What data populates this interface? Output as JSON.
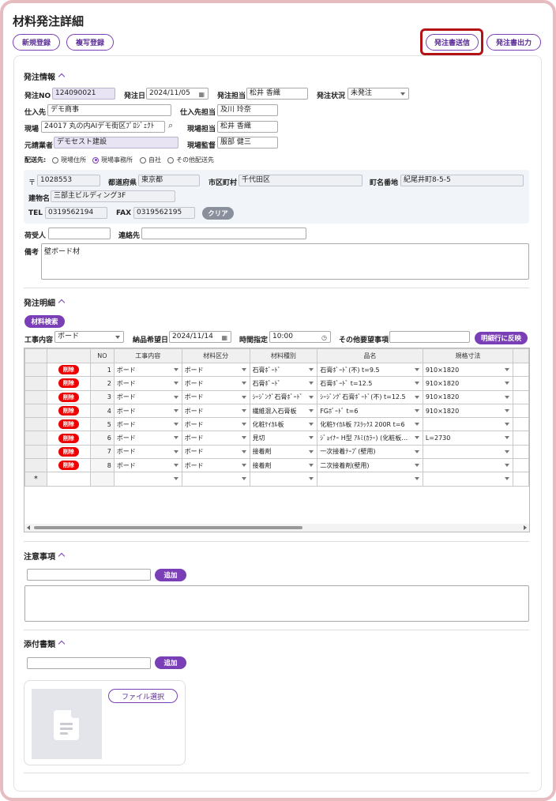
{
  "page_title": "材料発注詳細",
  "toolbar": {
    "new_label": "新規登録",
    "copy_label": "複写登録",
    "send_label": "発注書送信",
    "print_label": "発注書出力"
  },
  "order_info": {
    "section_title": "発注情報",
    "order_no_label": "発注NO",
    "order_no": "124090021",
    "order_date_label": "発注日",
    "order_date": "2024/11/05",
    "staff_label": "発注担当",
    "staff": "松井 香織",
    "status_label": "発注状況",
    "status": "未発注",
    "supplier_label": "仕入先",
    "supplier": "デモ商事",
    "supplier_staff_label": "仕入先担当",
    "supplier_staff": "及川 玲奈",
    "site_label": "現場",
    "site": "24017 丸の内AIデモ街区ﾌﾟﾛｼﾞｪｸﾄ",
    "site_staff_label": "現場担当",
    "site_staff": "松井 香織",
    "contractor_label": "元請業者",
    "contractor": "デモセスト建設",
    "site_supervisor_label": "現場監督",
    "site_supervisor": "服部 健三",
    "delivery_label": "配送先:",
    "delivery_options": [
      "現場住所",
      "現場事務所",
      "自社",
      "その他配送先"
    ],
    "zip_mark": "〒",
    "zip": "1028553",
    "pref_label": "都道府県",
    "pref": "東京都",
    "city_label": "市区町村",
    "city": "千代田区",
    "street_label": "町名番地",
    "street": "紀尾井町8-5-5",
    "building_label": "建物名",
    "building": "三部主ビルディング3F",
    "tel_label": "TEL",
    "tel": "0319562194",
    "fax_label": "FAX",
    "fax": "0319562195",
    "clear_label": "クリア",
    "receiver_label": "荷受人",
    "receiver": "",
    "contact_label": "連絡先",
    "contact": "",
    "remarks_label": "備考",
    "remarks": "壁ボード材"
  },
  "order_detail": {
    "section_title": "発注明細",
    "search_label": "材料検索",
    "work_label": "工事内容",
    "work": "ボード",
    "delivery_date_label": "納品希望日",
    "delivery_date": "2024/11/14",
    "time_label": "時間指定",
    "time": "10:00",
    "other_label": "その他要望事項",
    "other": "",
    "reflect_label": "明細行に反映",
    "columns": [
      "",
      "NO",
      "工事内容",
      "材料区分",
      "材料種別",
      "品名",
      "規格寸法"
    ],
    "delete_label": "削除",
    "new_row_mark": "*",
    "rows": [
      {
        "no": "1",
        "work": "ボード",
        "category": "ボード",
        "type": "石膏ﾎﾞｰﾄﾞ",
        "name": "石膏ﾎﾞｰﾄﾞ(不) t=9.5",
        "size": "910×1820"
      },
      {
        "no": "2",
        "work": "ボード",
        "category": "ボード",
        "type": "石膏ﾎﾞｰﾄﾞ",
        "name": "石膏ﾎﾞｰﾄﾞ t=12.5",
        "size": "910×1820"
      },
      {
        "no": "3",
        "work": "ボード",
        "category": "ボード",
        "type": "ｼｰｼﾞﾝｸﾞ石膏ﾎﾞｰﾄﾞ",
        "name": "ｼｰｼﾞﾝｸﾞ石膏ﾎﾞｰﾄﾞ(不) t=12.5",
        "size": "910×1820"
      },
      {
        "no": "4",
        "work": "ボード",
        "category": "ボード",
        "type": "繊維混入石膏板",
        "name": "FGﾎﾞｰﾄﾞ t=6",
        "size": "910×1820"
      },
      {
        "no": "5",
        "work": "ボード",
        "category": "ボード",
        "type": "化粧ｹｲｶﾙ板",
        "name": "化粧ｹｲｶﾙ板 ｱｽﾗｯｸｽ 200R t=6",
        "size": ""
      },
      {
        "no": "6",
        "work": "ボード",
        "category": "ボード",
        "type": "見切",
        "name": "ｼﾞｮｲﾅｰ H型 ｱﾙﾐ(ｶﾗｰ) (化粧板…",
        "size": "L=2730"
      },
      {
        "no": "7",
        "work": "ボード",
        "category": "ボード",
        "type": "接着剤",
        "name": "一次接着ﾃｰﾌﾟ(壁用)",
        "size": ""
      },
      {
        "no": "8",
        "work": "ボード",
        "category": "ボード",
        "type": "接着剤",
        "name": "二次接着剤(壁用)",
        "size": ""
      }
    ]
  },
  "notes": {
    "section_title": "注意事項",
    "add_label": "追加",
    "input": "",
    "text": ""
  },
  "attachments": {
    "section_title": "添付書類",
    "add_label": "追加",
    "input": "",
    "file_select_label": "ファイル選択"
  },
  "colors": {
    "accent": "#7a3fb7",
    "delete": "#e00000",
    "highlight": "#b31217",
    "readonly_bg": "#e8e4f4"
  }
}
